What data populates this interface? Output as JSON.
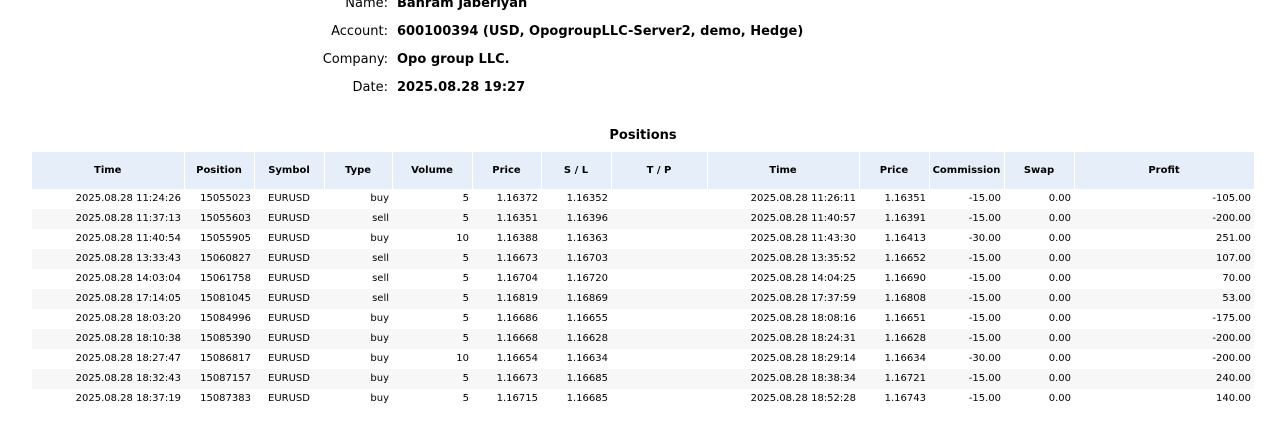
{
  "account_info": {
    "name_label": "Name:",
    "name_value": "Bahram Jaberiyan",
    "account_label": "Account:",
    "account_value": "600100394 (USD, OpogroupLLC-Server2, demo, Hedge)",
    "company_label": "Company:",
    "company_value": "Opo group LLC.",
    "date_label": "Date:",
    "date_value": "2025.08.28 19:27"
  },
  "positions": {
    "title": "Positions",
    "columns": [
      "Time",
      "Position",
      "Symbol",
      "Type",
      "Volume",
      "Price",
      "S / L",
      "T / P",
      "Time",
      "Price",
      "Commission",
      "Swap",
      "Profit"
    ],
    "rows": [
      {
        "open_time": "2025.08.28 11:24:26",
        "position": "15055023",
        "symbol": "EURUSD",
        "type": "buy",
        "volume": "5",
        "open_price": "1.16372",
        "sl": "1.16352",
        "tp": "",
        "close_time": "2025.08.28 11:26:11",
        "close_price": "1.16351",
        "commission": "-15.00",
        "swap": "0.00",
        "profit": "-105.00"
      },
      {
        "open_time": "2025.08.28 11:37:13",
        "position": "15055603",
        "symbol": "EURUSD",
        "type": "sell",
        "volume": "5",
        "open_price": "1.16351",
        "sl": "1.16396",
        "tp": "",
        "close_time": "2025.08.28 11:40:57",
        "close_price": "1.16391",
        "commission": "-15.00",
        "swap": "0.00",
        "profit": "-200.00"
      },
      {
        "open_time": "2025.08.28 11:40:54",
        "position": "15055905",
        "symbol": "EURUSD",
        "type": "buy",
        "volume": "10",
        "open_price": "1.16388",
        "sl": "1.16363",
        "tp": "",
        "close_time": "2025.08.28 11:43:30",
        "close_price": "1.16413",
        "commission": "-30.00",
        "swap": "0.00",
        "profit": "251.00"
      },
      {
        "open_time": "2025.08.28 13:33:43",
        "position": "15060827",
        "symbol": "EURUSD",
        "type": "sell",
        "volume": "5",
        "open_price": "1.16673",
        "sl": "1.16703",
        "tp": "",
        "close_time": "2025.08.28 13:35:52",
        "close_price": "1.16652",
        "commission": "-15.00",
        "swap": "0.00",
        "profit": "107.00"
      },
      {
        "open_time": "2025.08.28 14:03:04",
        "position": "15061758",
        "symbol": "EURUSD",
        "type": "sell",
        "volume": "5",
        "open_price": "1.16704",
        "sl": "1.16720",
        "tp": "",
        "close_time": "2025.08.28 14:04:25",
        "close_price": "1.16690",
        "commission": "-15.00",
        "swap": "0.00",
        "profit": "70.00"
      },
      {
        "open_time": "2025.08.28 17:14:05",
        "position": "15081045",
        "symbol": "EURUSD",
        "type": "sell",
        "volume": "5",
        "open_price": "1.16819",
        "sl": "1.16869",
        "tp": "",
        "close_time": "2025.08.28 17:37:59",
        "close_price": "1.16808",
        "commission": "-15.00",
        "swap": "0.00",
        "profit": "53.00"
      },
      {
        "open_time": "2025.08.28 18:03:20",
        "position": "15084996",
        "symbol": "EURUSD",
        "type": "buy",
        "volume": "5",
        "open_price": "1.16686",
        "sl": "1.16655",
        "tp": "",
        "close_time": "2025.08.28 18:08:16",
        "close_price": "1.16651",
        "commission": "-15.00",
        "swap": "0.00",
        "profit": "-175.00"
      },
      {
        "open_time": "2025.08.28 18:10:38",
        "position": "15085390",
        "symbol": "EURUSD",
        "type": "buy",
        "volume": "5",
        "open_price": "1.16668",
        "sl": "1.16628",
        "tp": "",
        "close_time": "2025.08.28 18:24:31",
        "close_price": "1.16628",
        "commission": "-15.00",
        "swap": "0.00",
        "profit": "-200.00"
      },
      {
        "open_time": "2025.08.28 18:27:47",
        "position": "15086817",
        "symbol": "EURUSD",
        "type": "buy",
        "volume": "10",
        "open_price": "1.16654",
        "sl": "1.16634",
        "tp": "",
        "close_time": "2025.08.28 18:29:14",
        "close_price": "1.16634",
        "commission": "-30.00",
        "swap": "0.00",
        "profit": "-200.00"
      },
      {
        "open_time": "2025.08.28 18:32:43",
        "position": "15087157",
        "symbol": "EURUSD",
        "type": "buy",
        "volume": "5",
        "open_price": "1.16673",
        "sl": "1.16685",
        "tp": "",
        "close_time": "2025.08.28 18:38:34",
        "close_price": "1.16721",
        "commission": "-15.00",
        "swap": "0.00",
        "profit": "240.00"
      },
      {
        "open_time": "2025.08.28 18:37:19",
        "position": "15087383",
        "symbol": "EURUSD",
        "type": "buy",
        "volume": "5",
        "open_price": "1.16715",
        "sl": "1.16685",
        "tp": "",
        "close_time": "2025.08.28 18:52:28",
        "close_price": "1.16743",
        "commission": "-15.00",
        "swap": "0.00",
        "profit": "140.00"
      }
    ]
  },
  "colors": {
    "header_bg": "#e6eef9",
    "row_alt_bg": "#f7f7f7"
  }
}
